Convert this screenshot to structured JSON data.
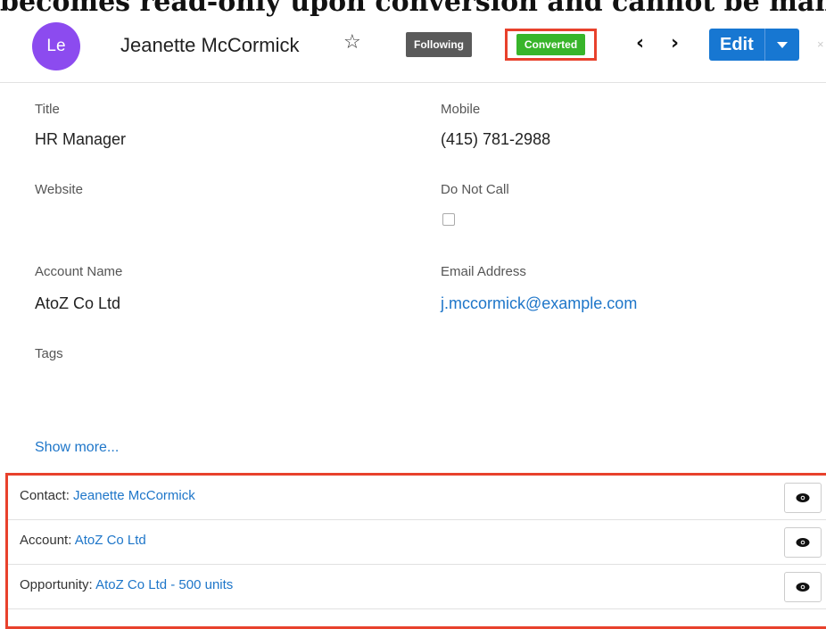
{
  "banner_text": "becomes read-only upon conversion and cannot be mana",
  "header": {
    "avatar_initials": "Le",
    "name": "Jeanette McCormick",
    "favorite_icon": "star-outline-icon",
    "following_label": "Following",
    "status_label": "Converted",
    "prev_icon": "chevron-left-icon",
    "next_icon": "chevron-right-icon",
    "edit_label": "Edit",
    "close_glyph": "×"
  },
  "fields": {
    "title_label": "Title",
    "title_value": "HR Manager",
    "mobile_label": "Mobile",
    "mobile_value": "(415) 781-2988",
    "website_label": "Website",
    "do_not_call_label": "Do Not Call",
    "do_not_call_checked": false,
    "account_name_label": "Account Name",
    "account_name_value": "AtoZ Co Ltd",
    "email_label": "Email Address",
    "email_value": "j.mccormick@example.com",
    "tags_label": "Tags"
  },
  "show_more_label": "Show more...",
  "related": [
    {
      "prefix": "Contact:",
      "link": "Jeanette McCormick"
    },
    {
      "prefix": "Account:",
      "link": "AtoZ Co Ltd"
    },
    {
      "prefix": "Opportunity:",
      "link": "AtoZ Co Ltd - 500 units"
    }
  ],
  "colors": {
    "avatar": "#8c4bef",
    "converted": "#38b52a",
    "highlight": "#e8412c",
    "link": "#1e76c9",
    "edit_button": "#1777d2"
  }
}
